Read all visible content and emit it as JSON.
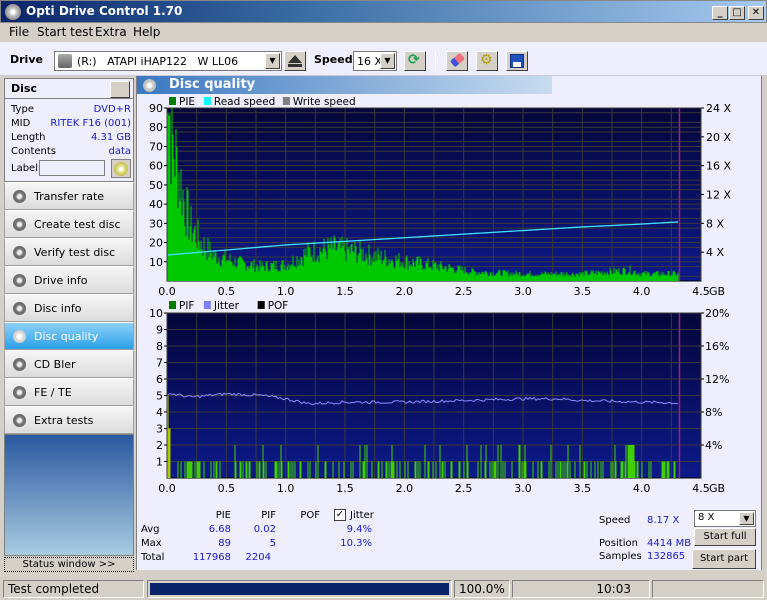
{
  "window": {
    "title": "Opti Drive Control 1.70",
    "controls": [
      "_",
      "□",
      "✕"
    ]
  },
  "menu": [
    "File",
    "Start test",
    "Extra",
    "Help"
  ],
  "toolbar": {
    "drive_label": "Drive",
    "drive_value": "(R:)   ATAPI iHAP122   W LL06",
    "speed_label": "Speed",
    "speed_value": "16 X",
    "icons": [
      "eject-icon",
      "refresh-icon",
      "erase-icon",
      "settings-icon",
      "save-icon"
    ]
  },
  "disc": {
    "header": "Disc",
    "rows": [
      {
        "k": "Type",
        "v": "DVD+R"
      },
      {
        "k": "MID",
        "v": "RITEK F16 (001)"
      },
      {
        "k": "Length",
        "v": "4.31 GB"
      },
      {
        "k": "Contents",
        "v": "data"
      }
    ],
    "label_key": "Label",
    "label_value": ""
  },
  "nav": [
    {
      "label": "Transfer rate",
      "active": false
    },
    {
      "label": "Create test disc",
      "active": false
    },
    {
      "label": "Verify test disc",
      "active": false
    },
    {
      "label": "Drive info",
      "active": false
    },
    {
      "label": "Disc info",
      "active": false
    },
    {
      "label": "Disc quality",
      "active": true
    },
    {
      "label": "CD Bler",
      "active": false
    },
    {
      "label": "FE / TE",
      "active": false
    },
    {
      "label": "Extra tests",
      "active": false
    }
  ],
  "status_window_button": "Status window >>",
  "panel_title": "Disc quality",
  "chart_data": [
    {
      "type": "bar",
      "title": "PIE / Read speed",
      "legend": [
        {
          "name": "PIE",
          "color": "#008000"
        },
        {
          "name": "Read speed",
          "color": "#00ffff"
        },
        {
          "name": "Write speed",
          "color": "#808080"
        }
      ],
      "legend_position": "top-left",
      "x_ticks": [
        "0.0",
        "0.5",
        "1.0",
        "1.5",
        "2.0",
        "2.5",
        "3.0",
        "3.5",
        "4.0",
        "4.5"
      ],
      "x_unit": "GB",
      "xlim": [
        0,
        4.5
      ],
      "ylim": [
        0,
        90
      ],
      "y_ticks": [
        "10",
        "20",
        "30",
        "40",
        "50",
        "60",
        "70",
        "80",
        "90"
      ],
      "y2_ticks": [
        "4 X",
        "8 X",
        "12 X",
        "16 X",
        "20 X",
        "24 X"
      ],
      "y2lim": [
        0,
        24
      ],
      "disc_end_gb": 4.31,
      "pie_profile": {
        "x": [
          0,
          0.02,
          0.05,
          0.1,
          0.15,
          0.2,
          0.3,
          0.4,
          0.6,
          0.8,
          1.0,
          1.2,
          1.4,
          1.6,
          1.8,
          2.0,
          2.2,
          2.4,
          2.6,
          3.0,
          3.5,
          3.9,
          4.0,
          4.31
        ],
        "y": [
          85,
          88,
          75,
          60,
          42,
          30,
          20,
          14,
          10,
          8,
          9,
          16,
          18,
          16,
          13,
          11,
          9,
          7,
          5,
          4,
          4,
          6,
          4,
          4
        ]
      },
      "read_speed": {
        "x": [
          0,
          0.5,
          1.0,
          1.5,
          2.0,
          2.5,
          3.0,
          3.5,
          4.0,
          4.31
        ],
        "y": [
          3.6,
          4.3,
          5.0,
          5.5,
          6.0,
          6.5,
          7.0,
          7.5,
          7.9,
          8.2
        ]
      }
    },
    {
      "type": "bar",
      "title": "PIF / Jitter",
      "legend": [
        {
          "name": "PIF",
          "color": "#008000"
        },
        {
          "name": "Jitter",
          "color": "#8080ff"
        },
        {
          "name": "POF",
          "color": "#000000"
        }
      ],
      "legend_position": "top-left",
      "x_ticks": [
        "0.0",
        "0.5",
        "1.0",
        "1.5",
        "2.0",
        "2.5",
        "3.0",
        "3.5",
        "4.0",
        "4.5"
      ],
      "x_unit": "GB",
      "xlim": [
        0,
        4.5
      ],
      "ylim": [
        0,
        10
      ],
      "y_ticks": [
        "1",
        "2",
        "3",
        "4",
        "5",
        "6",
        "7",
        "8",
        "9",
        "10"
      ],
      "y2_ticks": [
        "4%",
        "8%",
        "12%",
        "16%",
        "20%"
      ],
      "y2lim": [
        0,
        20
      ],
      "disc_end_gb": 4.31,
      "jitter": {
        "x": [
          0,
          0.2,
          0.5,
          0.8,
          1.0,
          1.2,
          1.5,
          2.0,
          2.5,
          3.0,
          3.3,
          3.5,
          4.0,
          4.31
        ],
        "y": [
          10.3,
          9.8,
          10.2,
          10.0,
          9.6,
          9.0,
          9.2,
          9.2,
          9.4,
          9.6,
          9.6,
          9.4,
          9.2,
          9.1
        ]
      },
      "pif_peaks": [
        {
          "x": 0.01,
          "y": 5
        },
        {
          "x": 0.03,
          "y": 3
        },
        {
          "x": 3.9,
          "y": 2
        },
        {
          "x": 3.92,
          "y": 2
        }
      ]
    }
  ],
  "stats": {
    "headers": [
      "PIE",
      "PIF",
      "POF"
    ],
    "jitter_label": "Jitter",
    "jitter_checked": true,
    "rows": [
      {
        "label": "Avg",
        "pie": "6.68",
        "pif": "0.02",
        "pof": "",
        "jitter": "9.4%"
      },
      {
        "label": "Max",
        "pie": "89",
        "pif": "5",
        "pof": "",
        "jitter": "10.3%"
      },
      {
        "label": "Total",
        "pie": "117968",
        "pif": "2204",
        "pof": "",
        "jitter": ""
      }
    ]
  },
  "run": {
    "speed_label": "Speed",
    "speed_value": "8.17 X",
    "position_label": "Position",
    "position_value": "4414 MB",
    "samples_label": "Samples",
    "samples_value": "132865",
    "speed_select": "8 X",
    "start_full": "Start full",
    "start_part": "Start part"
  },
  "statusbar": {
    "message": "Test completed",
    "progress": 1.0,
    "progress_text": "100.0%",
    "elapsed": "10:03"
  }
}
